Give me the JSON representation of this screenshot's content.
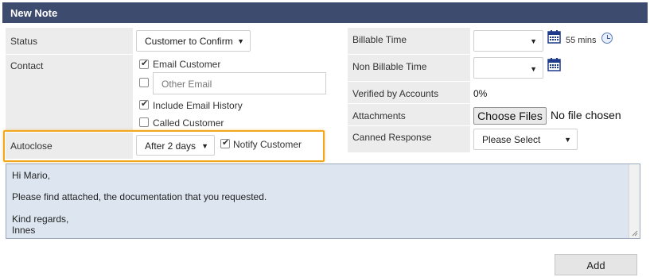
{
  "title": "New Note",
  "labels": {
    "status": "Status",
    "contact": "Contact",
    "autoclose": "Autoclose",
    "billable_time": "Billable Time",
    "non_billable_time": "Non Billable Time",
    "verified_by_accounts": "Verified by Accounts",
    "attachments": "Attachments",
    "canned_response": "Canned Response"
  },
  "status": {
    "selected": "Customer to Confirm"
  },
  "contact": {
    "email_customer": {
      "label": "Email Customer",
      "checked": true
    },
    "other_email": {
      "placeholder": "Other Email",
      "checked": false
    },
    "include_history": {
      "label": "Include Email History",
      "checked": true
    },
    "called_customer": {
      "label": "Called Customer",
      "checked": false
    }
  },
  "autoclose": {
    "selected": "After 2 days",
    "notify_customer": {
      "label": "Notify Customer",
      "checked": true
    }
  },
  "billable_time": {
    "selected": "",
    "total": "55 mins"
  },
  "non_billable_time": {
    "selected": ""
  },
  "verified_by_accounts": {
    "value": "0%"
  },
  "attachments": {
    "button": "Choose Files",
    "status": "No file chosen"
  },
  "canned_response": {
    "selected": "Please Select"
  },
  "note_body": {
    "lines": [
      "Hi Mario,",
      "Please find attached, the documentation that you requested.",
      "Kind regards,",
      "Innes"
    ]
  },
  "add_button": "Add",
  "colors": {
    "titlebar": "#3d4b6e",
    "label_cell": "#ececec",
    "highlight": "#f1a81d",
    "note_bg": "#dde6f0"
  },
  "icons": [
    "calendar-icon",
    "clock-icon",
    "chevron-down-icon",
    "checkbox-icon",
    "resize-handle-icon"
  ]
}
